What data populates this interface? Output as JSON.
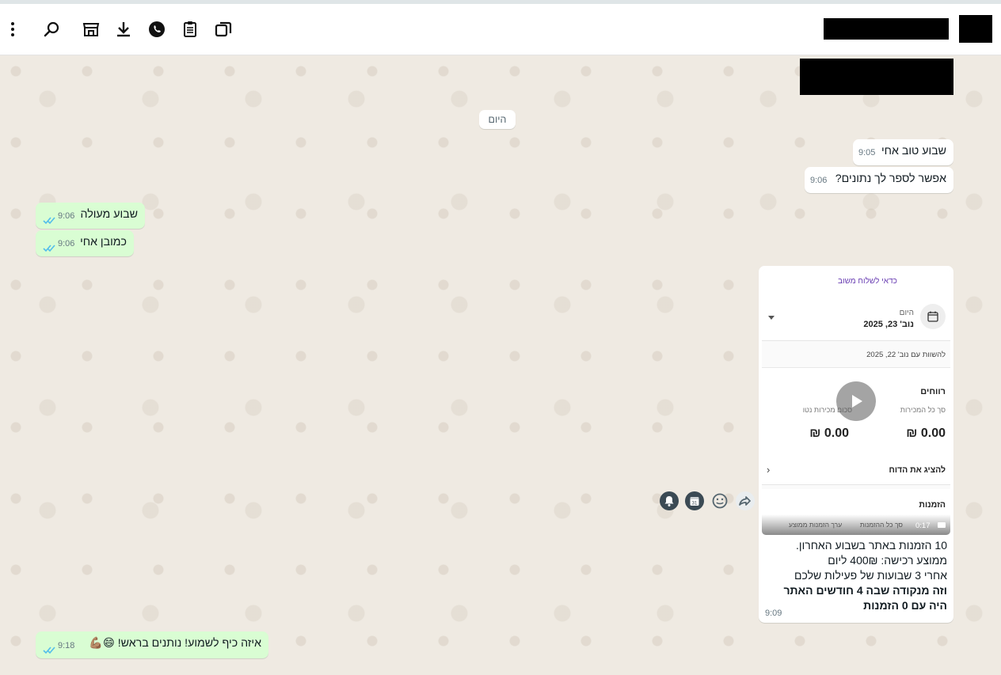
{
  "header": {
    "icons": [
      "more-icon",
      "search-icon",
      "store-icon",
      "download-icon",
      "whatsapp-icon",
      "clipboard-icon",
      "copy-icon"
    ]
  },
  "chat": {
    "date_chip": "היום",
    "messages": [
      {
        "id": "m1",
        "direction": "in",
        "text": "שבוע טוב אחי",
        "time": "9:05"
      },
      {
        "id": "m2",
        "direction": "in",
        "text": "אפשר לספר לך נתונים?",
        "time": "9:06"
      },
      {
        "id": "m3",
        "direction": "out",
        "text": "שבוע מעולה",
        "time": "9:06",
        "read": true
      },
      {
        "id": "m4",
        "direction": "out",
        "text": "כמובן אחי",
        "time": "9:06",
        "read": true
      },
      {
        "id": "m6",
        "direction": "out",
        "text": "איזה כיף לשמוע! נותנים בראש! 😄💪🏽",
        "time": "9:18",
        "read": true
      }
    ],
    "media": {
      "time": "9:09",
      "duration": "0:17",
      "caption_lines": [
        "10 הזמנות באתר בשבוע האחרון.",
        "ממוצע רכישה: 400₪ ליום",
        "אחרי 3 שבועות של פעילות שלכם"
      ],
      "caption_bold_lines": [
        "וזה מנקודה שבה 4 חודשים האתר",
        "היה עם 0 הזמנות"
      ],
      "screenshot": {
        "top_text": "כדאי לשלוח משוב",
        "date_label": "היום",
        "date_value": "נוב' 23, 2025",
        "compare_text": "להשוות עם נוב' 22, 2025",
        "profit_title": "רווחים",
        "profit_sub1": "סך כל המכירות",
        "profit_sub2": "סכום מכירות נטו",
        "profit_val1": "0.00 ₪",
        "profit_val2": "0.00 ₪",
        "report_link": "להציג את הדוח",
        "orders_title": "הזמנות",
        "orders_sub1": "סך כל ההזמנות",
        "orders_sub2": "ערך הזמנות ממוצע"
      }
    }
  },
  "colors": {
    "outgoing_bubble": "#d9fdd3",
    "incoming_bubble": "#ffffff",
    "chat_bg": "#efeae2",
    "read_ticks": "#53bdeb"
  }
}
